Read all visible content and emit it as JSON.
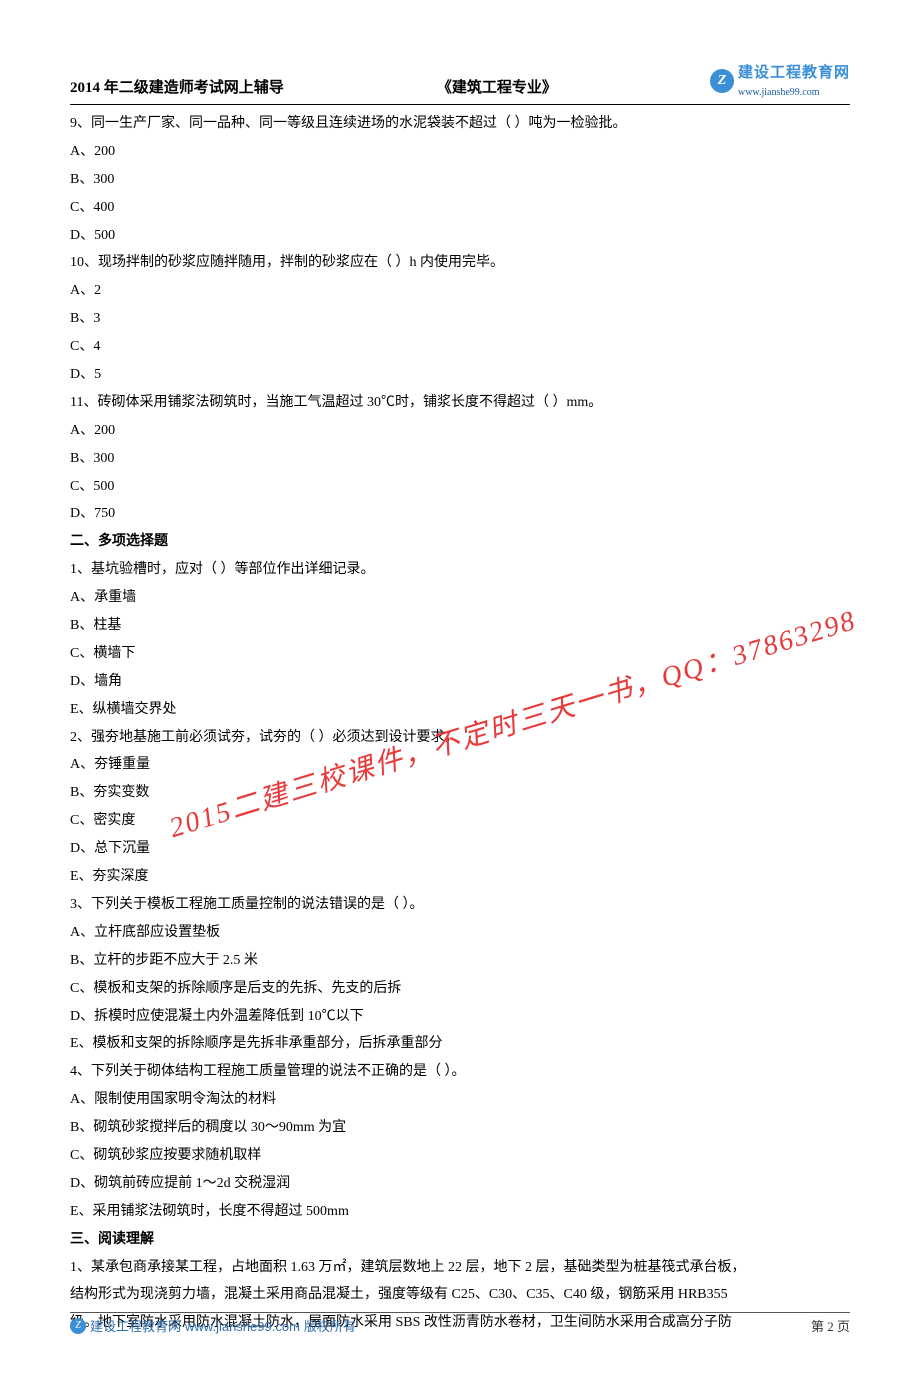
{
  "header": {
    "left": "2014 年二级建造师考试网上辅导",
    "center": "《建筑工程专业》",
    "logo_glyph": "Z",
    "logo_cn": "建设工程教育网",
    "logo_en": "www.jianshe99.com"
  },
  "watermark": "2015二建三校课件，不定时三天一书，QQ：37863298",
  "footer": {
    "logo_glyph": "Z",
    "site_name": "建设工程教育网",
    "url": "www.jianshe99.com",
    "copyright": "版权所有",
    "page_label": "第 2 页"
  },
  "sections": [
    {
      "q_num": "9、",
      "q_text": "同一生产厂家、同一品种、同一等级且连续进场的水泥袋装不超过（ ）吨为一检验批。",
      "options": {
        "A": "A、200",
        "B": "B、300",
        "C": "C、400",
        "D": "D、500"
      }
    },
    {
      "q_num": "10、",
      "q_text": "现场拌制的砂浆应随拌随用，拌制的砂浆应在（ ）h 内使用完毕。",
      "options": {
        "A": "A、2",
        "B": "B、3",
        "C": "C、4",
        "D": "D、5"
      }
    },
    {
      "q_num": "11、",
      "q_text": "砖砌体采用铺浆法砌筑时，当施工气温超过 30℃时，铺浆长度不得超过（ ）mm。",
      "options": {
        "A": "A、200",
        "B": "B、300",
        "C": "C、500",
        "D": "D、750"
      }
    }
  ],
  "multi_heading": "二、多项选择题",
  "multi": [
    {
      "q_num": "1、",
      "q_text": "基坑验槽时，应对（ ）等部位作出详细记录。",
      "options": {
        "A": "A、承重墙",
        "B": "B、柱基",
        "C": "C、横墙下",
        "D": "D、墙角",
        "E": "E、纵横墙交界处"
      }
    },
    {
      "q_num": "2、",
      "q_text": "强夯地基施工前必须试夯，试夯的（ ）必须达到设计要求。",
      "options": {
        "A": "A、夯锤重量",
        "B": "B、夯实变数",
        "C": "C、密实度",
        "D": "D、总下沉量",
        "E": "E、夯实深度"
      }
    },
    {
      "q_num": "3、",
      "q_text": "下列关于模板工程施工质量控制的说法错误的是（ ）。",
      "options": {
        "A": "A、立杆底部应设置垫板",
        "B": "B、立杆的步距不应大于 2.5 米",
        "C": "C、模板和支架的拆除顺序是后支的先拆、先支的后拆",
        "D": "D、拆模时应使混凝土内外温差降低到 10℃以下",
        "E": "E、模板和支架的拆除顺序是先拆非承重部分，后拆承重部分"
      }
    },
    {
      "q_num": "4、",
      "q_text": "下列关于砌体结构工程施工质量管理的说法不正确的是（  ）。",
      "options": {
        "A": "A、限制使用国家明令淘汰的材料",
        "B": "B、砌筑砂浆搅拌后的稠度以 30～90mm 为宜",
        "C": "C、砌筑砂浆应按要求随机取样",
        "D": "D、砌筑前砖应提前 1～2d 交税湿润",
        "E": "E、采用铺浆法砌筑时，长度不得超过 500mm"
      }
    }
  ],
  "reading_heading": "三、阅读理解",
  "reading": {
    "num": "1、",
    "lines": [
      "某承包商承接某工程，占地面积 1.63 万㎡，建筑层数地上 22 层，地下 2 层，基础类型为桩基筏式承台板，",
      "结构形式为现浇剪力墙，混凝土采用商品混凝土，强度等级有 C25、C30、C35、C40 级，钢筋采用 HRB355",
      "级。地下室防水采用防水混凝土防水，屋面防水采用 SBS 改性沥青防水卷材，卫生间防水采用合成高分子防"
    ]
  }
}
